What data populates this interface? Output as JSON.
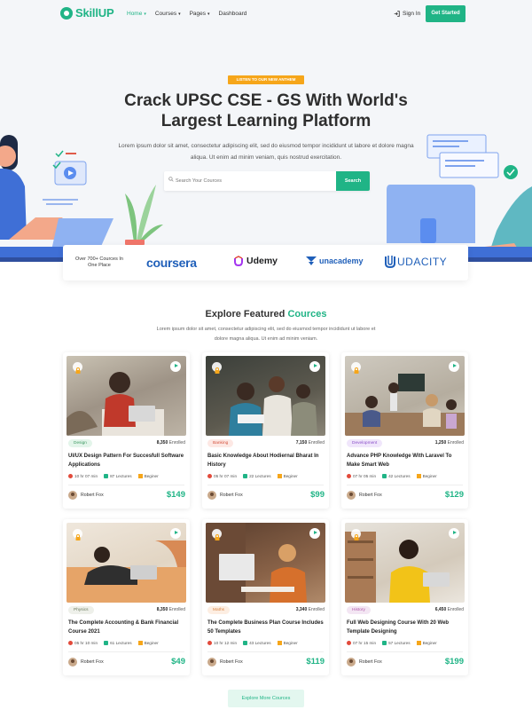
{
  "nav": {
    "logo_prefix": "Skill",
    "logo_suffix": "UP",
    "menu": [
      {
        "label": "Home",
        "active": true
      },
      {
        "label": "Courses",
        "active": false
      },
      {
        "label": "Pages",
        "active": false
      },
      {
        "label": "Dashboard",
        "active": false
      }
    ],
    "signin": "Sign In",
    "cta": "Get Started"
  },
  "hero": {
    "badge": "LISTEN TO OUR NEW ANTHEM",
    "title": "Crack UPSC CSE - GS With World's Largest Learning Platform",
    "description": "Lorem ipsum dolor sit amet, consectetur adipiscing elit, sed do eiusmod tempor incididunt ut labore et dolore magna aliqua. Ut enim ad minim veniam, quis nostrud exercitation.",
    "search_placeholder": "Search Your Cources",
    "search_button": "Search"
  },
  "partners": {
    "label": "Over 700+ Cources In One Place",
    "logos": [
      "coursera",
      "Udemy",
      "unacademy",
      "UDACITY"
    ]
  },
  "featured": {
    "title_main": "Explore Featured ",
    "title_highlight": "Cources",
    "description": "Lorem ipsum dolor sit amet, consectetur adipiscing elit, sed do eiusmod tempor incididunt ut labore et dolore magna aliqua. Ut enim ad minim veniam."
  },
  "courses": [
    {
      "category": "Design",
      "enrolled": "8,350",
      "enrolled_label": "Enrolled",
      "title": "UI/UX Design Pattern For Succesfull Software Applications",
      "time": "10 hr 07 min",
      "lectures": "87 Lectures",
      "level": "Beginer",
      "author": "Robert Fox",
      "price": "$149"
    },
    {
      "category": "Banking",
      "enrolled": "7,150",
      "enrolled_label": "Enrolled",
      "title": "Basic Knowledge About Hodiernal Bharat In History",
      "time": "05 hr 07 min",
      "lectures": "22 Lectures",
      "level": "Beginer",
      "author": "Robert Fox",
      "price": "$99"
    },
    {
      "category": "Development",
      "enrolled": "1,250",
      "enrolled_label": "Enrolled",
      "title": "Advance PHP Knowledge With Laravel To Make Smart Web",
      "time": "07 hr 05 min",
      "lectures": "42 Lectures",
      "level": "Beginer",
      "author": "Robert Fox",
      "price": "$129"
    },
    {
      "category": "Physics",
      "enrolled": "8,350",
      "enrolled_label": "Enrolled",
      "title": "The Complete Accounting & Bank Financial Course 2021",
      "time": "05 hr 10 min",
      "lectures": "61 Lectures",
      "level": "Beginer",
      "author": "Robert Fox",
      "price": "$49"
    },
    {
      "category": "Maths",
      "enrolled": "3,340",
      "enrolled_label": "Enrolled",
      "title": "The Complete Business Plan Course Includes 50 Templates",
      "time": "10 hr 12 min",
      "lectures": "43 Lectures",
      "level": "Beginer",
      "author": "Robert Fox",
      "price": "$119"
    },
    {
      "category": "History",
      "enrolled": "6,450",
      "enrolled_label": "Enrolled",
      "title": "Full Web Designing Course With 20 Web Template Designing",
      "time": "07 hr 15 min",
      "lectures": "57 Lectures",
      "level": "Beginer",
      "author": "Robert Fox",
      "price": "$199"
    }
  ],
  "explore_button": "Explore More Cources",
  "colors": {
    "accent": "#20b486",
    "badge": "#f6a61a",
    "brand_blue": "#1f5fb9",
    "hero_bg": "#f4f6f9"
  }
}
